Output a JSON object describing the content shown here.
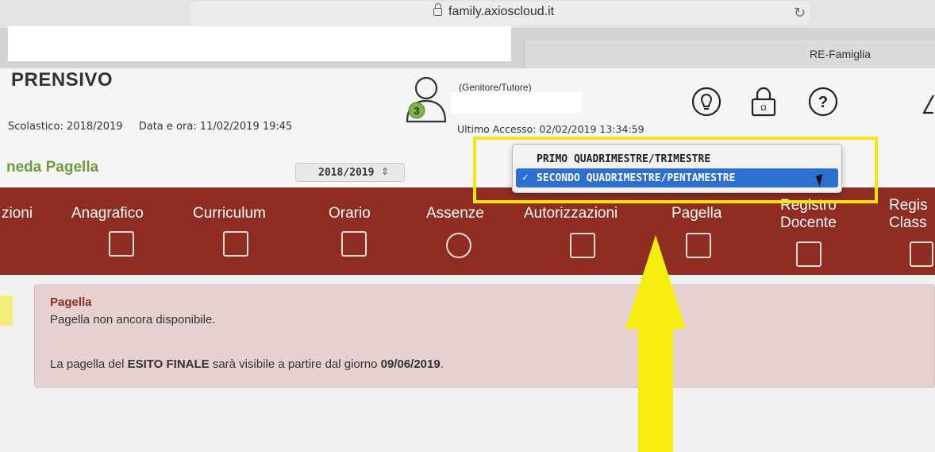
{
  "browser": {
    "url": "family.axioscloud.it",
    "tab_label": "RE-Famiglia"
  },
  "header": {
    "school_name": "PRENSIVO",
    "school_year": "Scolastico: 2018/2019",
    "datetime": "Data e ora: 11/02/2019 19:45",
    "avatar_badge": "3",
    "role": "(Genitore/Tutore)",
    "last_access": "Ultimo Accesso: 02/02/2019 13:34:59"
  },
  "toolbar": {
    "section_title": "neda Pagella",
    "year_select_value": "2018/2019",
    "year_caret": "⇕"
  },
  "period_dropdown": {
    "options": [
      {
        "label": "PRIMO QUADRIMESTRE/TRIMESTRE",
        "selected": false
      },
      {
        "label": "SECONDO QUADRIMESTRE/PENTAMESTRE",
        "selected": true
      }
    ],
    "check_mark": "✓"
  },
  "nav": {
    "items": [
      {
        "label": "zioni"
      },
      {
        "label": "Anagrafico"
      },
      {
        "label": "Curriculum"
      },
      {
        "label": "Orario"
      },
      {
        "label": "Assenze"
      },
      {
        "label": "Autorizzazioni"
      },
      {
        "label": "Pagella"
      },
      {
        "label": "Registro"
      },
      {
        "label": "Docente"
      },
      {
        "label": "Regis"
      },
      {
        "label": "Class"
      }
    ]
  },
  "card": {
    "title": "Pagella",
    "subtitle": "Pagella non ancora disponibile.",
    "msg_prefix": "La pagella del ",
    "msg_bold": "ESITO FINALE",
    "msg_middle": " sarà visibile a partire dal giorno ",
    "msg_date": "09/06/2019",
    "msg_suffix": "."
  },
  "colors": {
    "nav_background": "#8f2d23",
    "selected_option": "#2c6fd3",
    "annotation_yellow": "#f5ee0f",
    "section_title": "#6f9a3f"
  }
}
